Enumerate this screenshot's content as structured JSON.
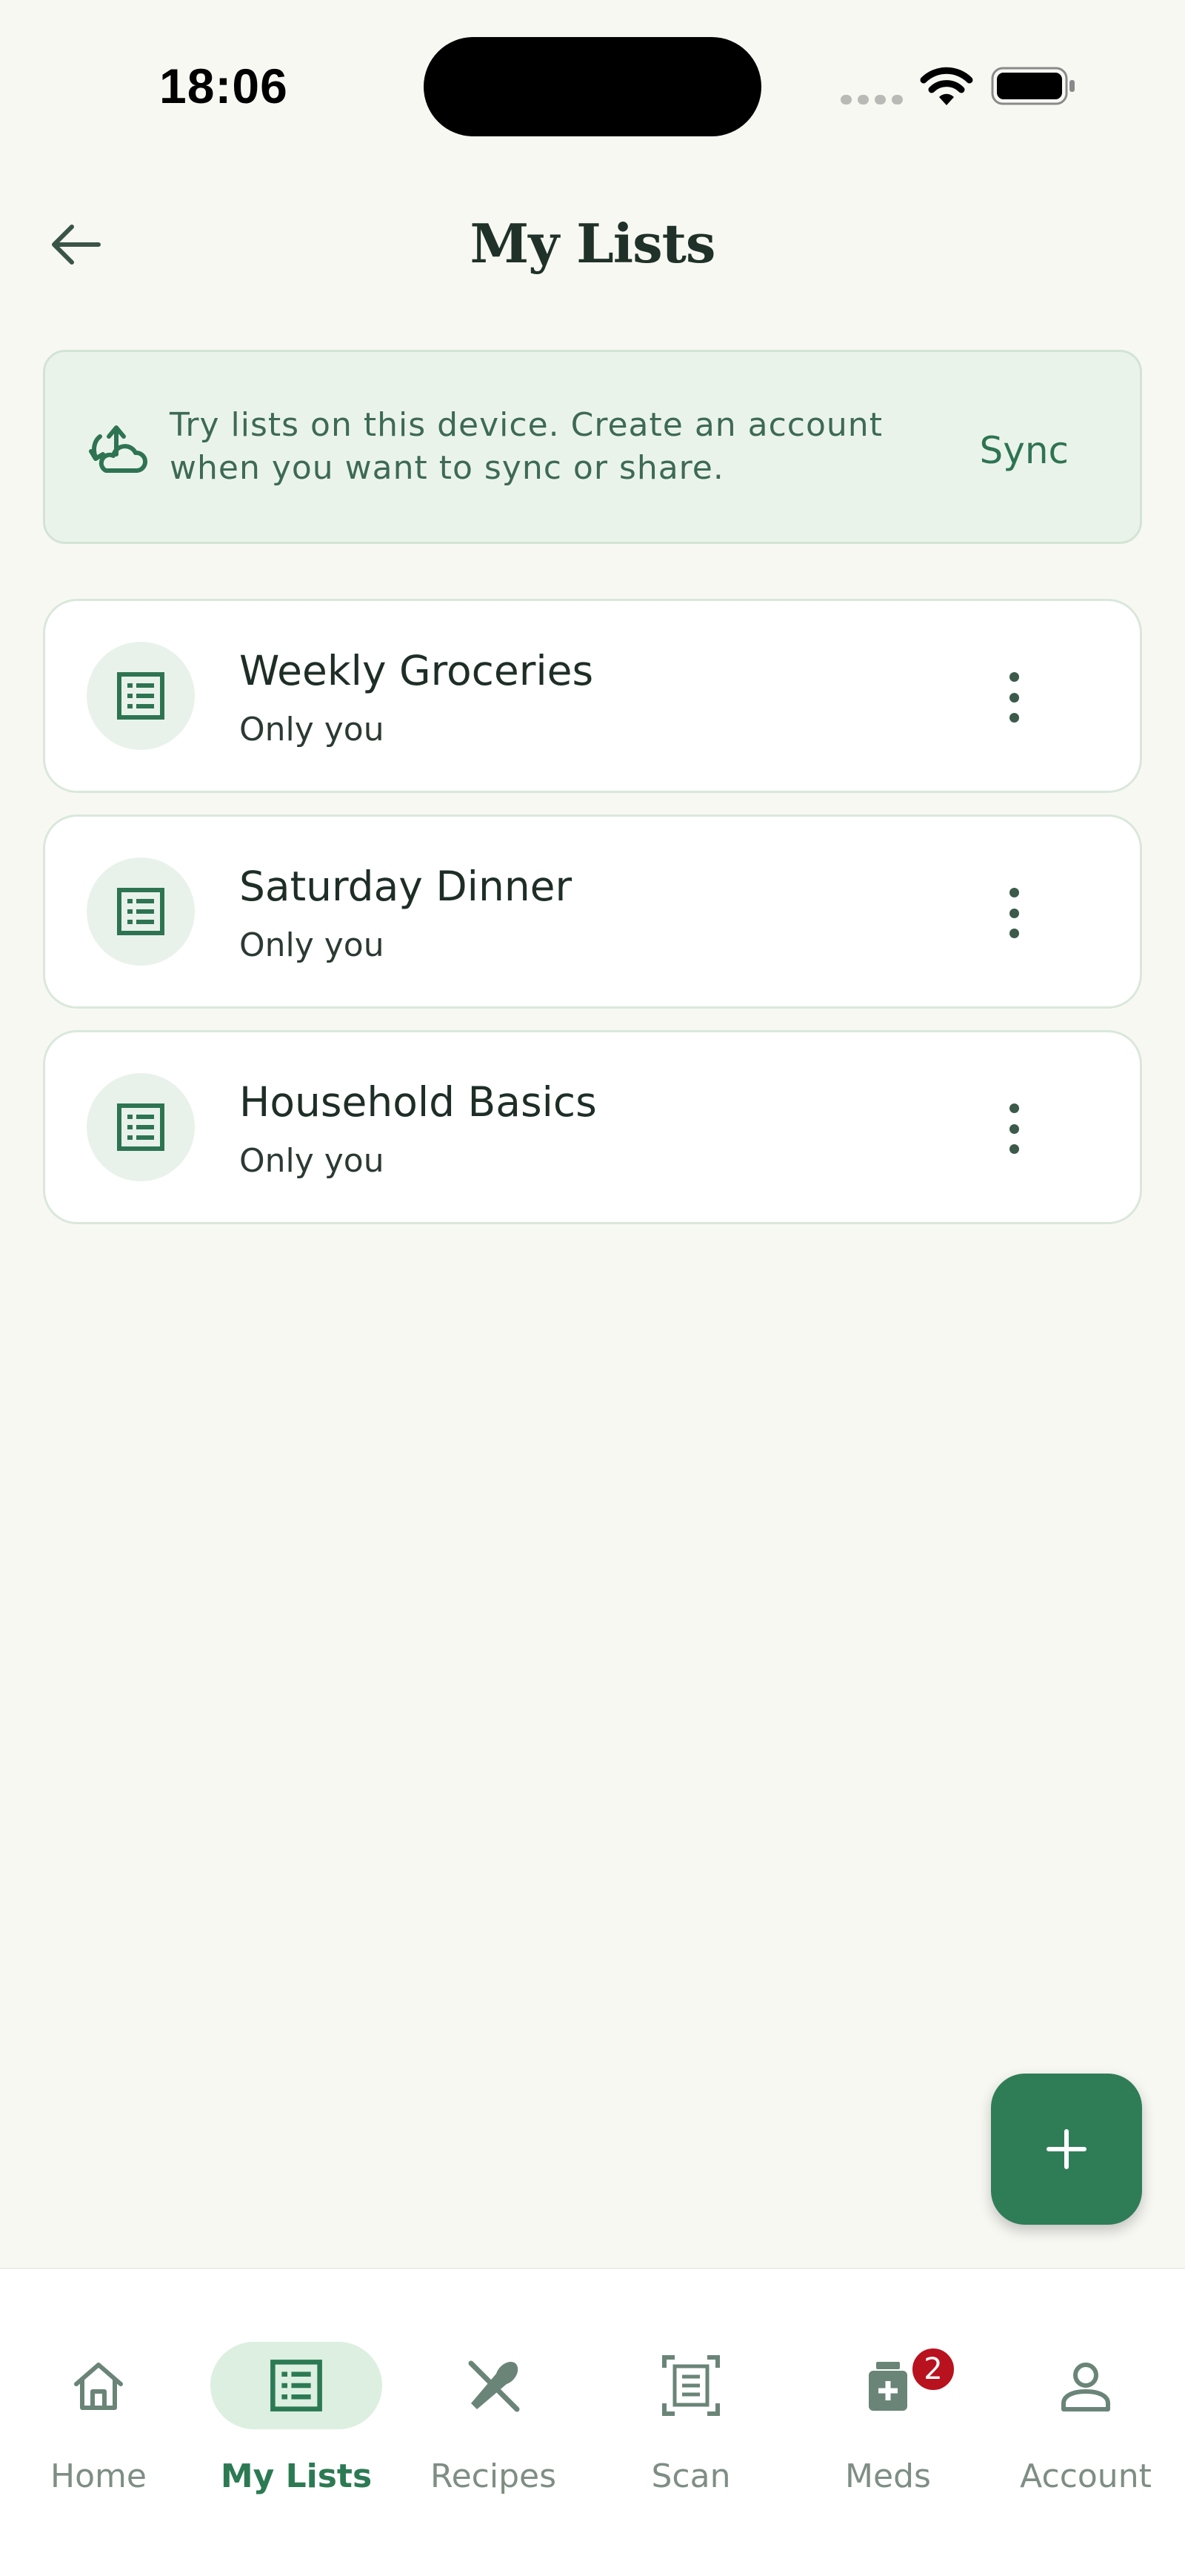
{
  "status_bar": {
    "time": "18:06"
  },
  "header": {
    "title": "My Lists"
  },
  "banner": {
    "message_line1": "Try lists on this device. Create an account",
    "message_line2": "when you want to sync or share.",
    "action_label": "Sync",
    "icon": "cloud-sync-icon"
  },
  "lists": [
    {
      "title": "Weekly Groceries",
      "subtitle": "Only you",
      "icon": "list-icon"
    },
    {
      "title": "Saturday Dinner",
      "subtitle": "Only you",
      "icon": "list-icon"
    },
    {
      "title": "Household Basics",
      "subtitle": "Only you",
      "icon": "list-icon"
    }
  ],
  "fab": {
    "icon": "plus-icon"
  },
  "nav": {
    "items": [
      {
        "label": "Home",
        "icon": "home-icon"
      },
      {
        "label": "My Lists",
        "icon": "list-icon",
        "active": true
      },
      {
        "label": "Recipes",
        "icon": "utensils-icon"
      },
      {
        "label": "Scan",
        "icon": "scan-icon"
      },
      {
        "label": "Meds",
        "icon": "meds-icon",
        "badge": "2"
      },
      {
        "label": "Account",
        "icon": "user-icon"
      }
    ]
  },
  "colors": {
    "accent": "#2f7d57",
    "background": "#f8f8f3",
    "banner_bg": "#eaf3ea",
    "badge": "#b8121e"
  }
}
